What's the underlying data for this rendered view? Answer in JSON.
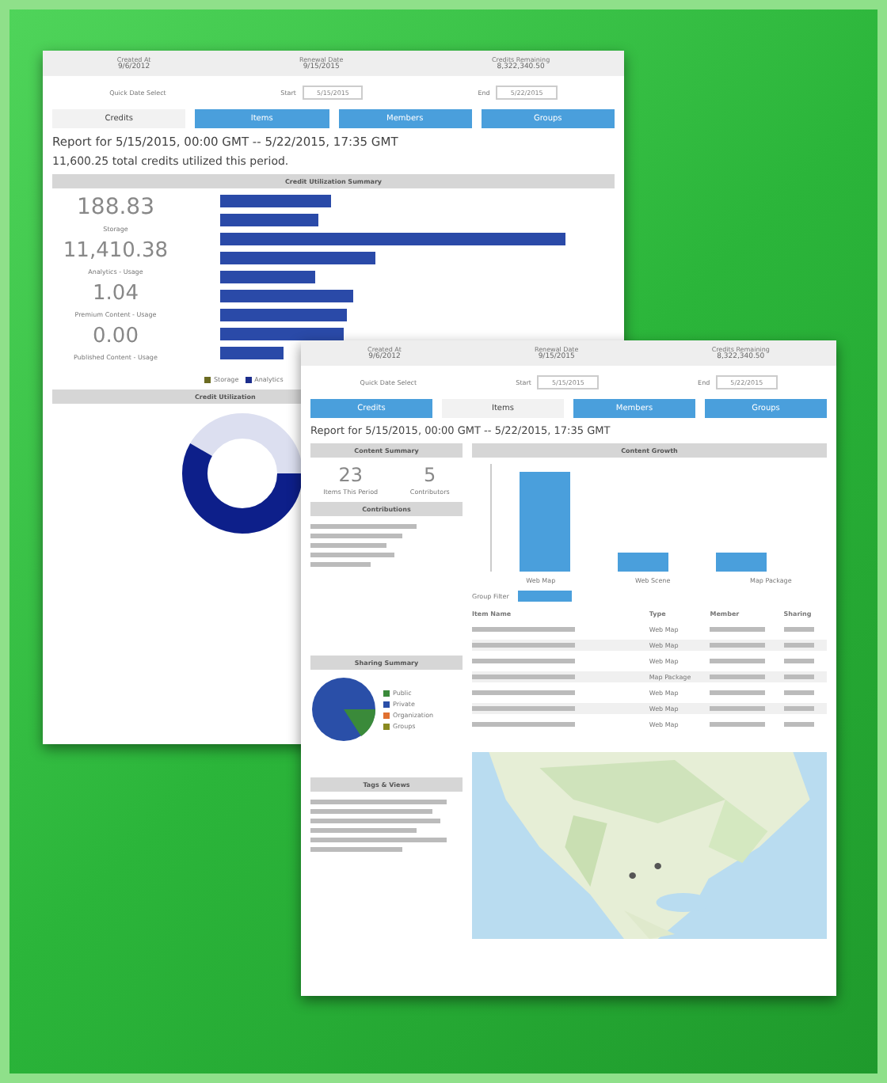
{
  "back_report": {
    "header": [
      {
        "label": "Created At",
        "value": "9/6/2012"
      },
      {
        "label": "Renewal Date",
        "value": "9/15/2015"
      },
      {
        "label": "Credits Remaining",
        "value": "8,322,340.50"
      }
    ],
    "quick_date": "Quick Date Select",
    "start_label": "Start",
    "start_value": "5/15/2015",
    "end_label": "End",
    "end_value": "5/22/2015",
    "tabs": [
      {
        "label": "Credits",
        "selected": true
      },
      {
        "label": "Items",
        "selected": false
      },
      {
        "label": "Members",
        "selected": false
      },
      {
        "label": "Groups",
        "selected": false
      }
    ],
    "report_title": "Report for 5/15/2015, 00:00 GMT -- 5/22/2015, 17:35 GMT",
    "total": "11,600.25 total credits utilized this period.",
    "section": "Credit Utilization Summary",
    "stats": [
      {
        "value": "188.83",
        "label": "Storage"
      },
      {
        "value": "11,410.38",
        "label": "Analytics - Usage"
      },
      {
        "value": "1.04",
        "label": "Premium Content - Usage"
      },
      {
        "value": "0.00",
        "label": "Published Content - Usage"
      }
    ],
    "legend": [
      {
        "label": "Storage",
        "color": "#6b6b22"
      },
      {
        "label": "Analytics",
        "color": "#1c2d8c"
      }
    ],
    "section2": "Credit Utilization"
  },
  "front_report": {
    "header": [
      {
        "label": "Created At",
        "value": "9/6/2012"
      },
      {
        "label": "Renewal Date",
        "value": "9/15/2015"
      },
      {
        "label": "Credits Remaining",
        "value": "8,322,340.50"
      }
    ],
    "quick_date": "Quick Date Select",
    "start_label": "Start",
    "start_value": "5/15/2015",
    "end_label": "End",
    "end_value": "5/22/2015",
    "tabs": [
      {
        "label": "Credits",
        "selected": false
      },
      {
        "label": "Items",
        "selected": true
      },
      {
        "label": "Members",
        "selected": false
      },
      {
        "label": "Groups",
        "selected": false
      }
    ],
    "report_title": "Report for 5/15/2015, 00:00 GMT -- 5/22/2015, 17:35 GMT",
    "content_summary": "Content Summary",
    "counts": [
      {
        "value": "23",
        "label": "Items This Period"
      },
      {
        "value": "5",
        "label": "Contributors"
      }
    ],
    "contributions": "Contributions",
    "content_growth": "Content Growth",
    "chart_categories": [
      "Web Map",
      "Web Scene",
      "Map Package"
    ],
    "group_filter": "Group Filter",
    "table_columns": [
      "Item Name",
      "Type",
      "Member",
      "Sharing"
    ],
    "table_types": [
      "Web Map",
      "Web Map",
      "Web Map",
      "Map Package",
      "Web Map",
      "Web Map",
      "Web Map"
    ],
    "sharing_summary": "Sharing Summary",
    "sharing_legend": [
      {
        "label": "Public",
        "color": "#3a8a3a"
      },
      {
        "label": "Private",
        "color": "#2a4fa8"
      },
      {
        "label": "Organization",
        "color": "#e07030"
      },
      {
        "label": "Groups",
        "color": "#8a8a20"
      }
    ],
    "tags_title": "Tags & Views"
  }
}
